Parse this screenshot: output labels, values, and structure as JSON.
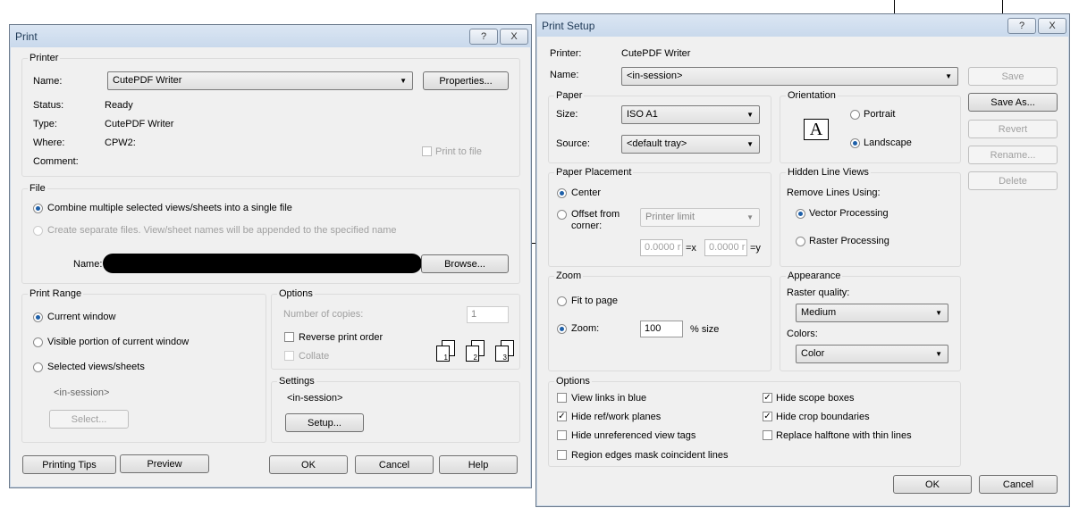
{
  "print": {
    "title": "Print",
    "help": "?",
    "close": "X",
    "printer": {
      "group": "Printer",
      "name_label": "Name:",
      "name_value": "CutePDF Writer",
      "properties": "Properties...",
      "status_label": "Status:",
      "status": "Ready",
      "type_label": "Type:",
      "type": "CutePDF Writer",
      "where_label": "Where:",
      "where": "CPW2:",
      "comment_label": "Comment:",
      "print_to_file": "Print to file"
    },
    "file": {
      "group": "File",
      "combine": "Combine multiple selected views/sheets into a single file",
      "separate": "Create separate files. View/sheet names will be appended to the specified name",
      "name_label": "Name:",
      "browse": "Browse..."
    },
    "range": {
      "group": "Print Range",
      "current": "Current window",
      "visible": "Visible portion of current window",
      "selected": "Selected views/sheets",
      "session": "<in-session>",
      "select": "Select..."
    },
    "options": {
      "group": "Options",
      "copies_label": "Number of copies:",
      "copies": "1",
      "reverse": "Reverse print order",
      "collate": "Collate",
      "pages": [
        "1",
        "2",
        "3"
      ]
    },
    "settings": {
      "group": "Settings",
      "value": "<in-session>",
      "setup": "Setup..."
    },
    "buttons": {
      "tips": "Printing Tips",
      "preview": "Preview",
      "ok": "OK",
      "cancel": "Cancel",
      "help": "Help"
    }
  },
  "setup": {
    "title": "Print Setup",
    "help": "?",
    "close": "X",
    "printer_label": "Printer:",
    "printer": "CutePDF Writer",
    "name_label": "Name:",
    "name": "<in-session>",
    "side": {
      "save": "Save",
      "save_as": "Save As...",
      "revert": "Revert",
      "rename": "Rename...",
      "delete": "Delete"
    },
    "paper": {
      "group": "Paper",
      "size_label": "Size:",
      "size": "ISO A1",
      "source_label": "Source:",
      "source": "<default tray>"
    },
    "orientation": {
      "group": "Orientation",
      "icon_letter": "A",
      "portrait": "Portrait",
      "landscape": "Landscape"
    },
    "placement": {
      "group": "Paper Placement",
      "center": "Center",
      "offset": "Offset from",
      "corner": "corner:",
      "limit": "Printer limit",
      "x": "0.0000 r",
      "xl": "=x",
      "y": "0.0000 r",
      "yl": "=y"
    },
    "hidden": {
      "group": "Hidden Line Views",
      "remove": "Remove Lines Using:",
      "vector": "Vector Processing",
      "raster": "Raster Processing"
    },
    "zoom": {
      "group": "Zoom",
      "fit": "Fit to page",
      "zoom": "Zoom:",
      "value": "100",
      "unit": "% size"
    },
    "appearance": {
      "group": "Appearance",
      "quality_label": "Raster quality:",
      "quality": "Medium",
      "colors_label": "Colors:",
      "colors": "Color"
    },
    "options": {
      "group": "Options",
      "links": "View links in blue",
      "ref": "Hide ref/work planes",
      "unref": "Hide unreferenced view tags",
      "region": "Region edges mask coincident lines",
      "scope": "Hide scope boxes",
      "crop": "Hide crop boundaries",
      "halftone": "Replace halftone with thin lines"
    },
    "ok": "OK",
    "cancel": "Cancel"
  }
}
